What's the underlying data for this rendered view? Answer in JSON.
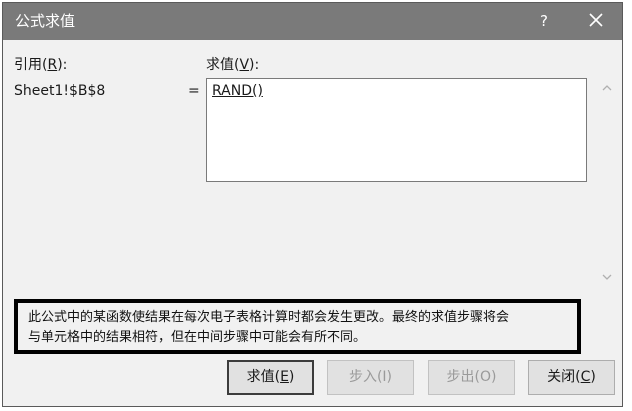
{
  "window": {
    "title": "公式求值",
    "help_label": "?"
  },
  "reference": {
    "label_prefix": "引用(",
    "label_key": "R",
    "label_suffix": "):",
    "value": "Sheet1!$B$8",
    "equals": "="
  },
  "evaluation": {
    "label_prefix": "求值(",
    "label_key": "V",
    "label_suffix": "):",
    "expression": "RAND()"
  },
  "notice": {
    "line1": "此公式中的某函数使结果在每次电子表格计算时都会发生更改。最终的求值步骤将会",
    "line2": "与单元格中的结果相符，但在中间步骤中可能会有所不同。"
  },
  "buttons": {
    "evaluate": {
      "prefix": "求值(",
      "key": "E",
      "suffix": ")"
    },
    "step_in": "步入(I)",
    "step_out": "步出(O)",
    "close": {
      "prefix": "关闭(",
      "key": "C",
      "suffix": ")"
    }
  },
  "icons": {
    "close": "close-icon",
    "scroll_up": "scroll-up-arrow-icon",
    "scroll_down": "scroll-down-arrow-icon"
  },
  "colors": {
    "titlebar": "#7a7a7a",
    "dialog_bg": "#f1f1f1",
    "notice_border": "#000000"
  }
}
